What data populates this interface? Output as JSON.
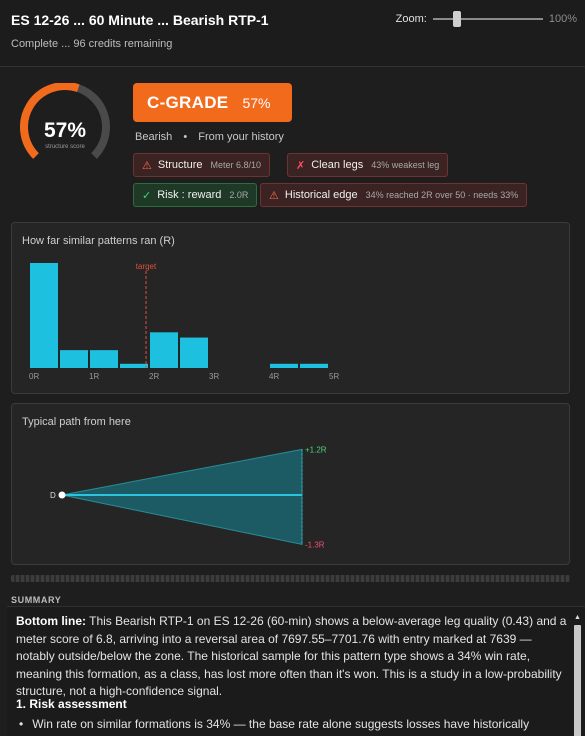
{
  "header": {
    "title": "ES 12-26 ... 60 Minute ... Bearish RTP-1",
    "subtitle": "Complete ... 96 credits remaining",
    "zoom_label": "Zoom:",
    "zoom_value": "100%",
    "zoom_fraction": 0.22
  },
  "score": {
    "value_text": "57%",
    "fraction": 0.57,
    "caption": "structure score",
    "ring_color": "#f26b1d",
    "track_color": "#4a4a4a"
  },
  "grade": {
    "name": "C-GRADE",
    "percent": "57%",
    "color": "#f26b1d"
  },
  "context": {
    "direction": "Bearish",
    "separator": "•",
    "source": "From your history"
  },
  "badges": [
    {
      "icon": "warning-icon",
      "glyph": "⚠",
      "label": "Structure",
      "detail": "Meter 6.8/10",
      "status": "bad"
    },
    {
      "icon": "x-icon",
      "glyph": "✗",
      "label": "Clean legs",
      "detail": "43% weakest leg",
      "status": "bad"
    },
    {
      "icon": "check-icon",
      "glyph": "✓",
      "label": "Risk : reward",
      "detail": "2.0R",
      "status": "good"
    },
    {
      "icon": "warning-icon",
      "glyph": "⚠",
      "label": "Historical edge",
      "detail": "34% reached 2R over 50 · needs 33%",
      "status": "bad"
    }
  ],
  "histogram": {
    "title": "How far similar patterns ran (R)",
    "target_label": "target"
  },
  "path": {
    "title": "Typical path from here",
    "start_label": "D",
    "upper_label": "+1.2R",
    "lower_label": "-1.3R"
  },
  "summary": {
    "heading": "SUMMARY",
    "bottom_line_label": "Bottom line:",
    "bottom_line_text": " This Bearish RTP-1 on ES 12-26 (60-min) shows a below-average leg quality (0.43) and a meter score of 6.8, arriving into a reversal area of 7697.55–7701.76 with entry marked at 7639 — notably outside/below the zone. The historical sample for this pattern type shows a 34% win rate, meaning this formation, as a class, has lost more often than it's won. This is a study in a low-probability structure, not a high-confidence signal.",
    "section_title": "1. Risk assessment",
    "bullet_1": "Win rate on similar formations is 34% — the base rate alone suggests losses have historically"
  },
  "chart_data": [
    {
      "type": "bar",
      "title": "How far similar patterns ran (R)",
      "bin_width": 0.5,
      "bins": [
        {
          "x": 0.0,
          "value": 1.0
        },
        {
          "x": 0.5,
          "value": 0.17
        },
        {
          "x": 1.0,
          "value": 0.17
        },
        {
          "x": 1.5,
          "value": 0.04
        },
        {
          "x": 2.0,
          "value": 0.34
        },
        {
          "x": 2.5,
          "value": 0.29
        },
        {
          "x": 3.0,
          "value": 0.0
        },
        {
          "x": 3.5,
          "value": 0.0
        },
        {
          "x": 4.0,
          "value": 0.04
        },
        {
          "x": 4.5,
          "value": 0.04
        },
        {
          "x": 5.0,
          "value": 0.0
        }
      ],
      "xlim": [
        0,
        5.5
      ],
      "xticks": [
        "0R",
        "1R",
        "2R",
        "3R",
        "4R",
        "5R"
      ],
      "target_x": 1.95,
      "bar_color": "#1ec0e0",
      "target_color": "#e0503a"
    },
    {
      "type": "area",
      "title": "Typical path from here",
      "start": 0,
      "upper": 1.2,
      "lower": -1.3,
      "fill_color": "#1b6e7a",
      "line_color": "#2bc4dc"
    }
  ]
}
